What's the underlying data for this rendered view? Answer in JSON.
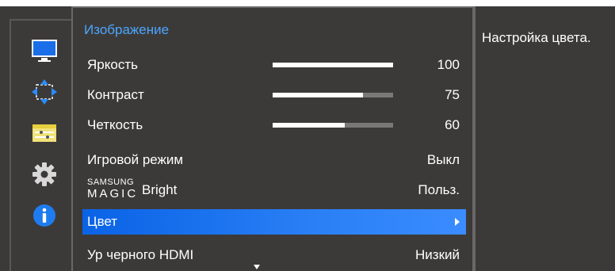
{
  "menu": {
    "title": "Изображение",
    "items": [
      {
        "label": "Яркость",
        "value": "100",
        "level": 1.0
      },
      {
        "label": "Контраст",
        "value": "75",
        "level": 0.75
      },
      {
        "label": "Четкость",
        "value": "60",
        "level": 0.6
      },
      {
        "label": "Игровой режим",
        "value": "Выкл"
      },
      {
        "label_small": "SAMSUNG",
        "label_magic": "MAGIC",
        "label_bright": "Bright",
        "value": "Польз."
      },
      {
        "label": "Цвет",
        "selected": true
      },
      {
        "label": "Ур черного HDMI",
        "value": "Низкий"
      }
    ]
  },
  "help": {
    "text": "Настройка цвета."
  },
  "sidebar": {
    "icons": [
      "monitor-icon",
      "position-arrows-icon",
      "settings-list-icon",
      "gear-icon",
      "info-icon"
    ],
    "active": "monitor-icon"
  },
  "colors": {
    "background": "#3c3a39",
    "accent": "#4aa6ff",
    "selection": "#2a7ff5"
  }
}
